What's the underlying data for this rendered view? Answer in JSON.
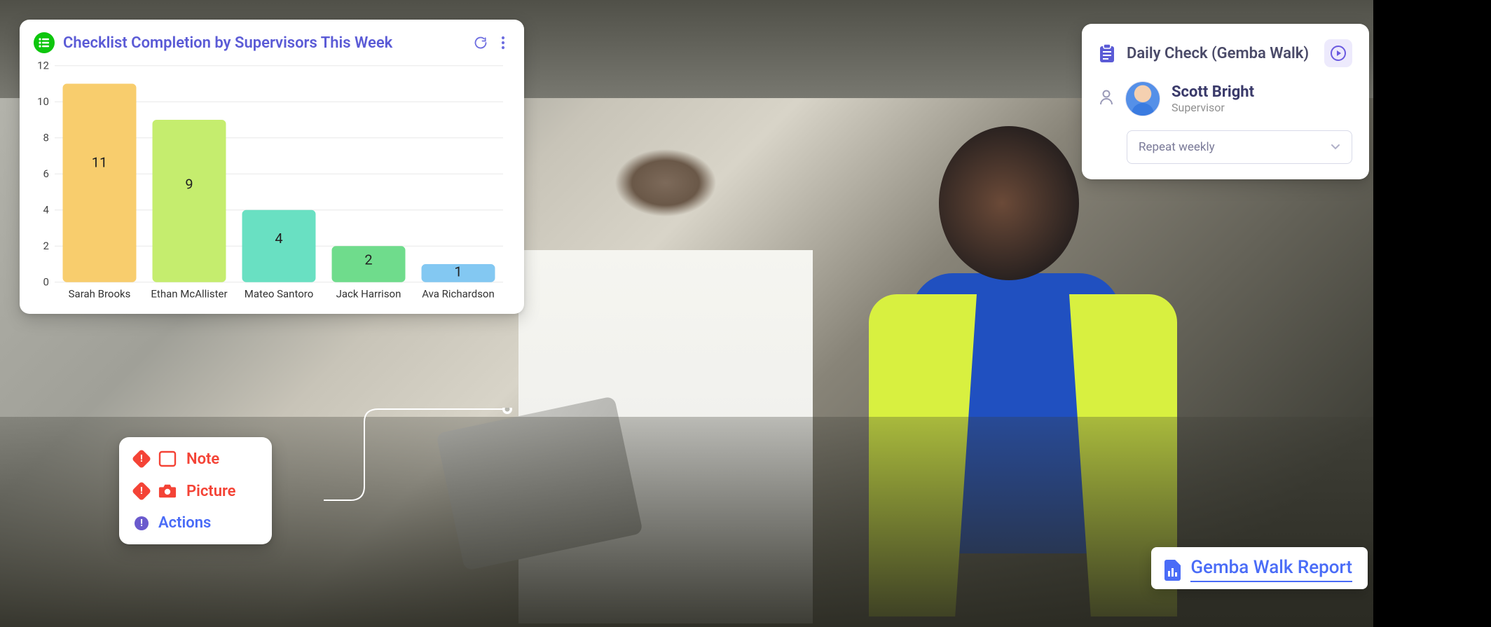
{
  "chart_data": {
    "type": "bar",
    "title": "Checklist Completion by Supervisors This Week",
    "categories": [
      "Sarah Brooks",
      "Ethan McAllister",
      "Mateo Santoro",
      "Jack Harrison",
      "Ava Richardson"
    ],
    "values": [
      11,
      9,
      4,
      2,
      1
    ],
    "colors": [
      "#f8cd6d",
      "#c5ed6e",
      "#69e0c2",
      "#6fdc8c",
      "#83c8f2"
    ],
    "ylim": [
      0,
      12
    ],
    "yticks": [
      0,
      2,
      4,
      6,
      8,
      10,
      12
    ],
    "xlabel": "",
    "ylabel": ""
  },
  "actions_menu": {
    "items": [
      {
        "kind": "note",
        "label": "Note",
        "badge": "!"
      },
      {
        "kind": "picture",
        "label": "Picture",
        "badge": "!"
      },
      {
        "kind": "actions",
        "label": "Actions",
        "badge": "!"
      }
    ]
  },
  "assignee_card": {
    "title": "Daily Check (Gemba Walk)",
    "user": {
      "name": "Scott Bright",
      "role": "Supervisor"
    },
    "repeat": "Repeat weekly"
  },
  "report_chip": {
    "label": "Gemba Walk Report"
  }
}
